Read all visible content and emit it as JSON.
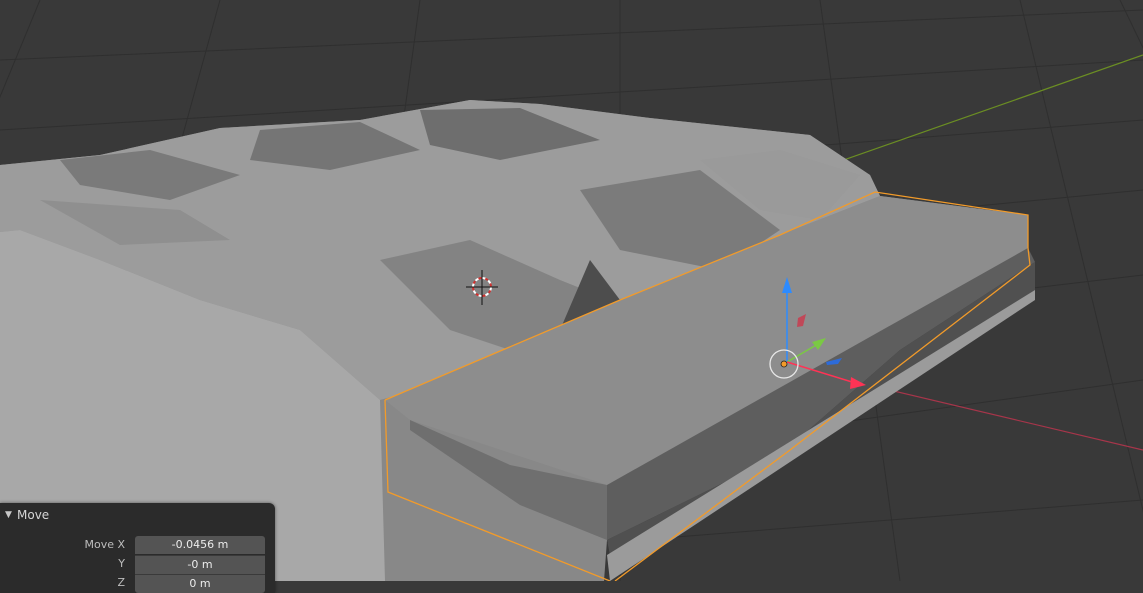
{
  "operator_panel": {
    "title": "Move",
    "fields": [
      {
        "label": "Move X",
        "value": "-0.0456 m"
      },
      {
        "label": "Y",
        "value": "-0 m"
      },
      {
        "label": "Z",
        "value": "0 m"
      }
    ]
  },
  "colors": {
    "background": "#393939",
    "grid": "#2f2f2f",
    "x_axis": "#a7354a",
    "y_axis": "#6b8e23",
    "z_gizmo": "#2d8bff",
    "selection": "#f29b2a",
    "mesh_light": "#a9a9a9",
    "mesh_dark": "#5c5c5c"
  },
  "icons": {
    "cursor": "3d-cursor-icon",
    "gizmo": "transform-gizmo-icon",
    "chevron": "chevron-down-icon"
  }
}
